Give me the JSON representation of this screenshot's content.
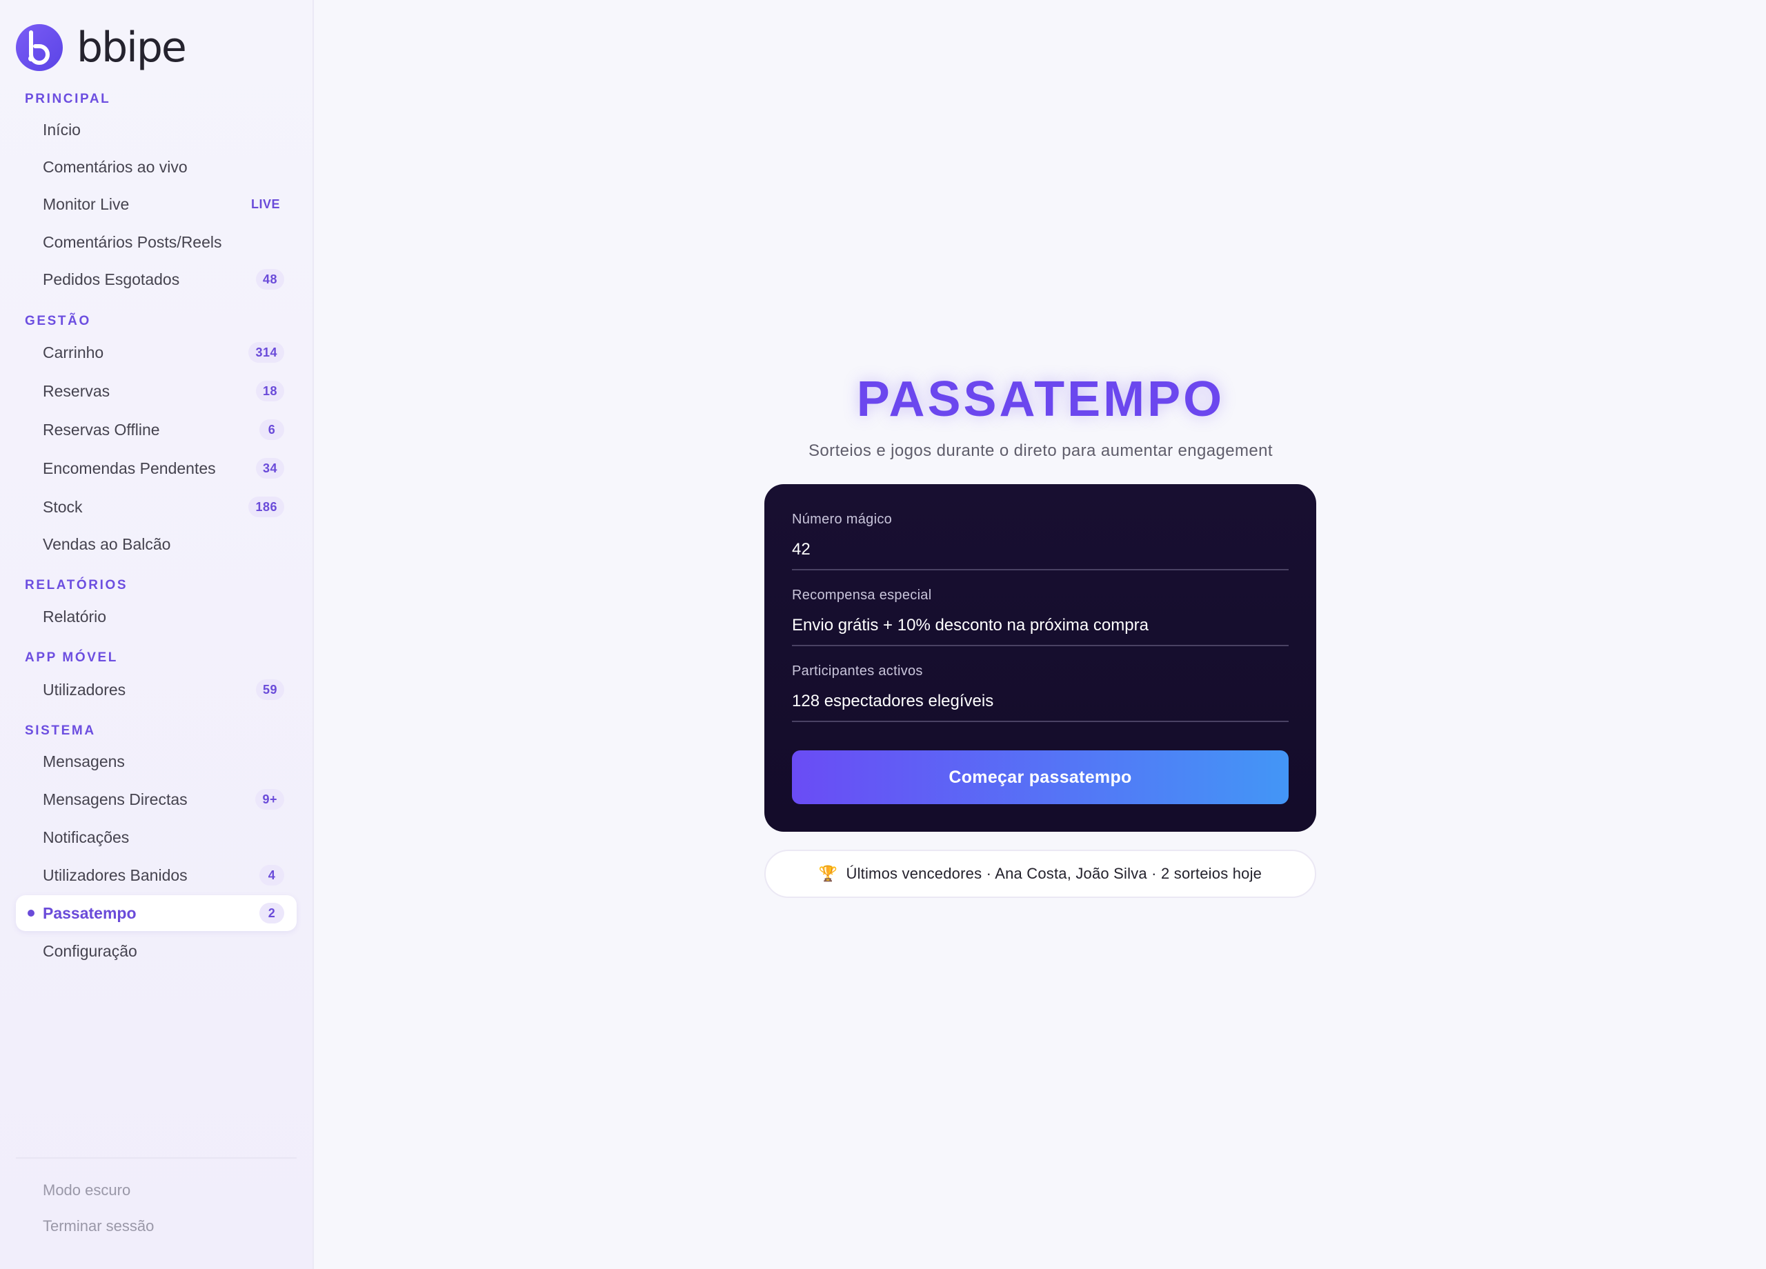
{
  "brand": {
    "name": "bbipe",
    "accent": "#6b47ee"
  },
  "sidebar": {
    "sections": {
      "principal": "PRINCIPAL",
      "gestao": "GESTÃO",
      "relatorios": "RELATÓRIOS",
      "app_movel": "APP MÓVEL",
      "sistema": "SISTEMA"
    },
    "items": {
      "inicio": {
        "label": "Início"
      },
      "comentarios_vivo": {
        "label": "Comentários ao vivo"
      },
      "monitor_live": {
        "label": "Monitor Live",
        "badge": "LIVE"
      },
      "comentarios_posts": {
        "label": "Comentários Posts/Reels"
      },
      "pedidos_esgotados": {
        "label": "Pedidos Esgotados",
        "badge": "48"
      },
      "carrinho": {
        "label": "Carrinho",
        "badge": "314"
      },
      "reservas": {
        "label": "Reservas",
        "badge": "18"
      },
      "reservas_offline": {
        "label": "Reservas Offline",
        "badge": "6"
      },
      "encomendas_pendentes": {
        "label": "Encomendas Pendentes",
        "badge": "34"
      },
      "stock": {
        "label": "Stock",
        "badge": "186"
      },
      "vendas_balcao": {
        "label": "Vendas ao Balcão"
      },
      "relatorio": {
        "label": "Relatório"
      },
      "utilizadores": {
        "label": "Utilizadores",
        "badge": "59"
      },
      "mensagens": {
        "label": "Mensagens"
      },
      "mensagens_directas": {
        "label": "Mensagens Directas",
        "badge": "9+"
      },
      "notificacoes": {
        "label": "Notificações"
      },
      "utilizadores_banidos": {
        "label": "Utilizadores Banidos",
        "badge": "4"
      },
      "passatempo": {
        "label": "Passatempo",
        "badge": "2",
        "active": true
      },
      "configuracao": {
        "label": "Configuração"
      }
    },
    "footer": {
      "dark_mode": "Modo escuro",
      "logout": "Terminar sessão"
    }
  },
  "main": {
    "title": "PASSATEMPO",
    "subtitle": "Sorteios e jogos durante o direto para aumentar engagement",
    "form": {
      "magic_number": {
        "label": "Número mágico",
        "value": "42"
      },
      "reward": {
        "label": "Recompensa especial",
        "value": "Envio grátis + 10% desconto na próxima compra"
      },
      "participants": {
        "label": "Participantes activos",
        "value": "128 espectadores elegíveis"
      },
      "start_button": "Começar passatempo"
    },
    "winners": {
      "icon": "trophy-icon",
      "text": "Últimos vencedores · Ana Costa, João Silva · 2 sorteios hoje"
    }
  }
}
